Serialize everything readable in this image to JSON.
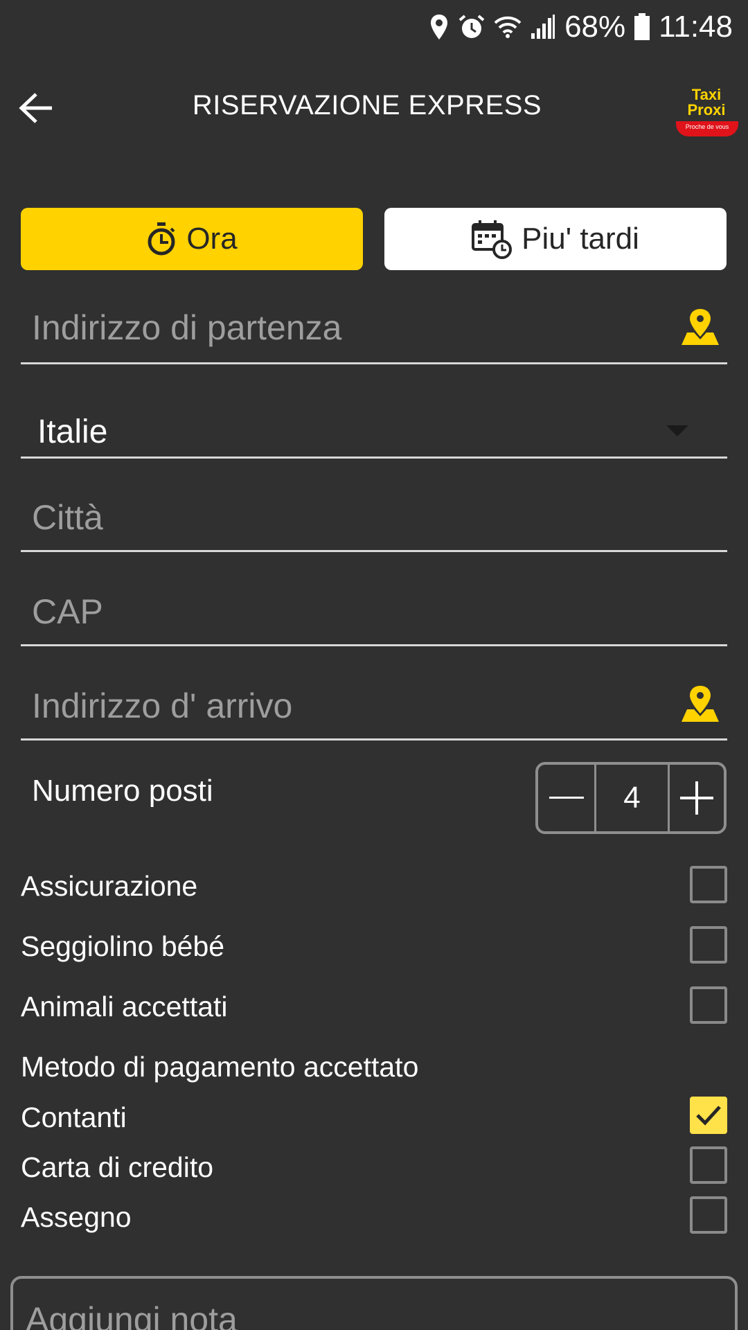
{
  "status_bar": {
    "battery": "68%",
    "time": "11:48",
    "icons": [
      "location-icon",
      "alarm-icon",
      "wifi-icon",
      "signal-icon",
      "battery-icon"
    ]
  },
  "app_bar": {
    "title": "RISERVAZIONE EXPRESS",
    "logo": {
      "line1": "Taxi",
      "line2": "Proxi",
      "tagline": "Proche de vous"
    }
  },
  "mode": {
    "now_label": "Ora",
    "later_label": "Piu' tardi",
    "selected": "now"
  },
  "form": {
    "departure_placeholder": "Indirizzo di partenza",
    "country_value": "Italie",
    "city_placeholder": "Città",
    "postal_placeholder": "CAP",
    "arrival_placeholder": "Indirizzo d' arrivo",
    "seats_label": "Numero posti",
    "seats_value": "4"
  },
  "options": [
    {
      "label": "Assicurazione",
      "checked": false
    },
    {
      "label": "Seggiolino bébé",
      "checked": false
    },
    {
      "label": "Animali accettati",
      "checked": false
    }
  ],
  "payment": {
    "heading": "Metodo di pagamento accettato",
    "methods": [
      {
        "label": "Contanti",
        "checked": true
      },
      {
        "label": "Carta di credito",
        "checked": false
      },
      {
        "label": "Assegno",
        "checked": false
      }
    ]
  },
  "note": {
    "placeholder": "Aggiungi nota"
  },
  "colors": {
    "background": "#303030",
    "accent": "#ffd200",
    "checkbox_checked": "#ffe14a",
    "logo_red": "#e0131a"
  }
}
